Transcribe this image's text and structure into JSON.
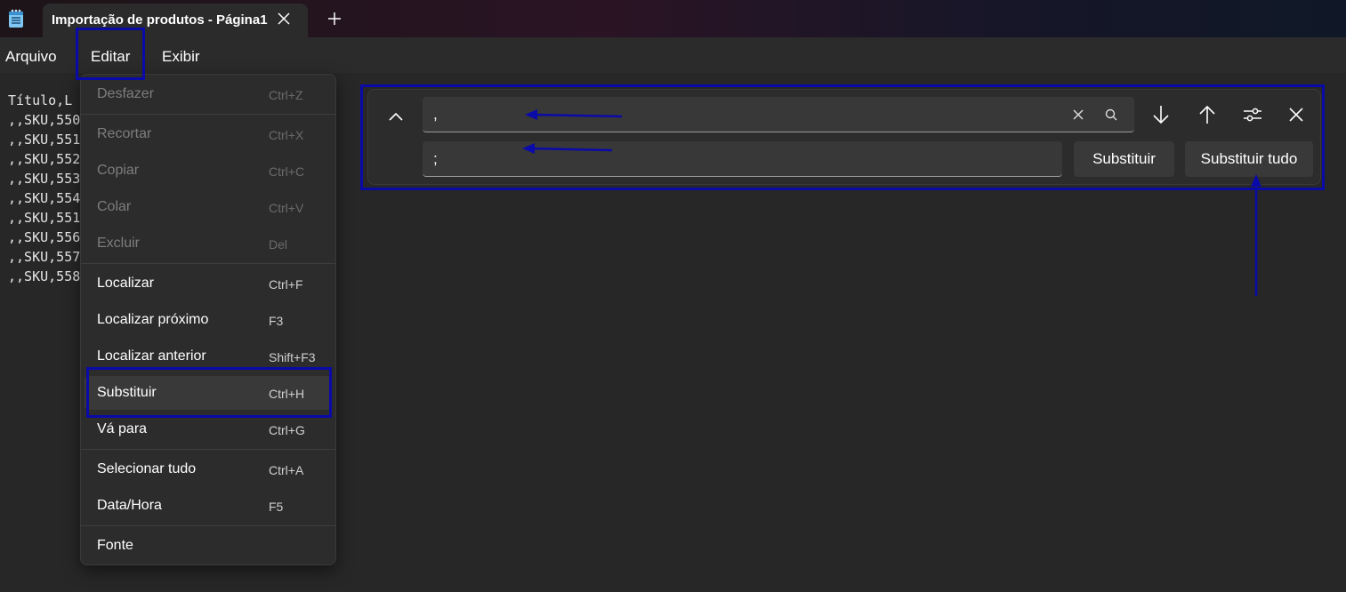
{
  "window": {
    "tab_title": "Importação de produtos - Página1"
  },
  "menubar": {
    "items": [
      "Arquivo",
      "Editar",
      "Exibir"
    ]
  },
  "editor": {
    "lines": [
      "Título,L",
      ",,SKU,550",
      ",,SKU,551",
      ",,SKU,552",
      ",,SKU,553",
      ",,SKU,554",
      ",,SKU,551",
      ",,SKU,556",
      ",,SKU,557",
      ",,SKU,558"
    ]
  },
  "edit_menu": {
    "items": [
      {
        "label": "Desfazer",
        "shortcut": "Ctrl+Z",
        "disabled": true
      },
      {
        "label": "Recortar",
        "shortcut": "Ctrl+X",
        "disabled": true
      },
      {
        "label": "Copiar",
        "shortcut": "Ctrl+C",
        "disabled": true
      },
      {
        "label": "Colar",
        "shortcut": "Ctrl+V",
        "disabled": true
      },
      {
        "label": "Excluir",
        "shortcut": "Del",
        "disabled": true
      },
      {
        "label": "Localizar",
        "shortcut": "Ctrl+F",
        "disabled": false
      },
      {
        "label": "Localizar próximo",
        "shortcut": "F3",
        "disabled": false
      },
      {
        "label": "Localizar anterior",
        "shortcut": "Shift+F3",
        "disabled": false
      },
      {
        "label": "Substituir",
        "shortcut": "Ctrl+H",
        "disabled": false,
        "active": true
      },
      {
        "label": "Vá para",
        "shortcut": "Ctrl+G",
        "disabled": false
      },
      {
        "label": "Selecionar tudo",
        "shortcut": "Ctrl+A",
        "disabled": false
      },
      {
        "label": "Data/Hora",
        "shortcut": "F5",
        "disabled": false
      },
      {
        "label": "Fonte",
        "shortcut": "",
        "disabled": false
      }
    ]
  },
  "find_replace": {
    "find_value": ",",
    "replace_value": ";",
    "replace_label": "Substituir",
    "replace_all_label": "Substituir tudo"
  },
  "colors": {
    "annotation": "#0a0aa8",
    "background": "#272727",
    "panel": "#2c2c2c"
  }
}
